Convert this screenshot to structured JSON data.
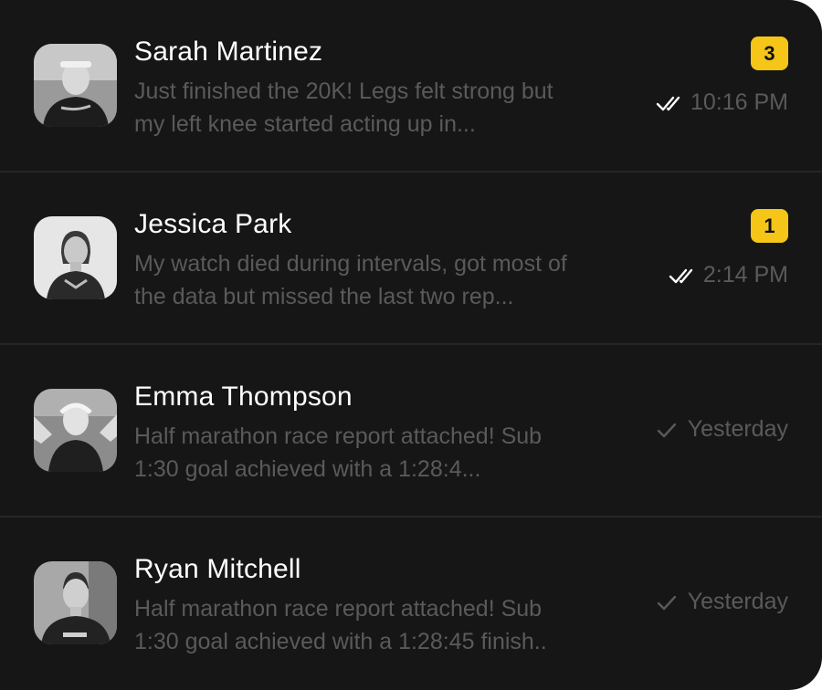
{
  "conversations": [
    {
      "name": "Sarah Martinez",
      "preview_line1": "Just finished the 20K! Legs felt strong but",
      "preview_line2": "my left knee started acting up in...",
      "unread_count": "3",
      "time": "10:16 PM",
      "receipt_icon": "double-check-icon"
    },
    {
      "name": "Jessica Park",
      "preview_line1": "My watch died during intervals, got most of",
      "preview_line2": "the data but missed the last two rep...",
      "unread_count": "1",
      "time": "2:14 PM",
      "receipt_icon": "double-check-icon"
    },
    {
      "name": "Emma Thompson",
      "preview_line1": "Half marathon race report attached! Sub",
      "preview_line2": "1:30 goal achieved with a 1:28:4...",
      "unread_count": null,
      "time": "Yesterday",
      "receipt_icon": "single-check-icon"
    },
    {
      "name": "Ryan Mitchell",
      "preview_line1": "Half marathon race report attached! Sub",
      "preview_line2": "1:30 goal achieved with a 1:28:45 finish..",
      "unread_count": null,
      "time": "Yesterday",
      "receipt_icon": "single-check-icon"
    }
  ],
  "colors": {
    "background": "#161616",
    "divider": "#262626",
    "name_text": "#ffffff",
    "muted_text": "#5a5a5a",
    "badge": "#f5c518",
    "check": "#ffffff"
  }
}
